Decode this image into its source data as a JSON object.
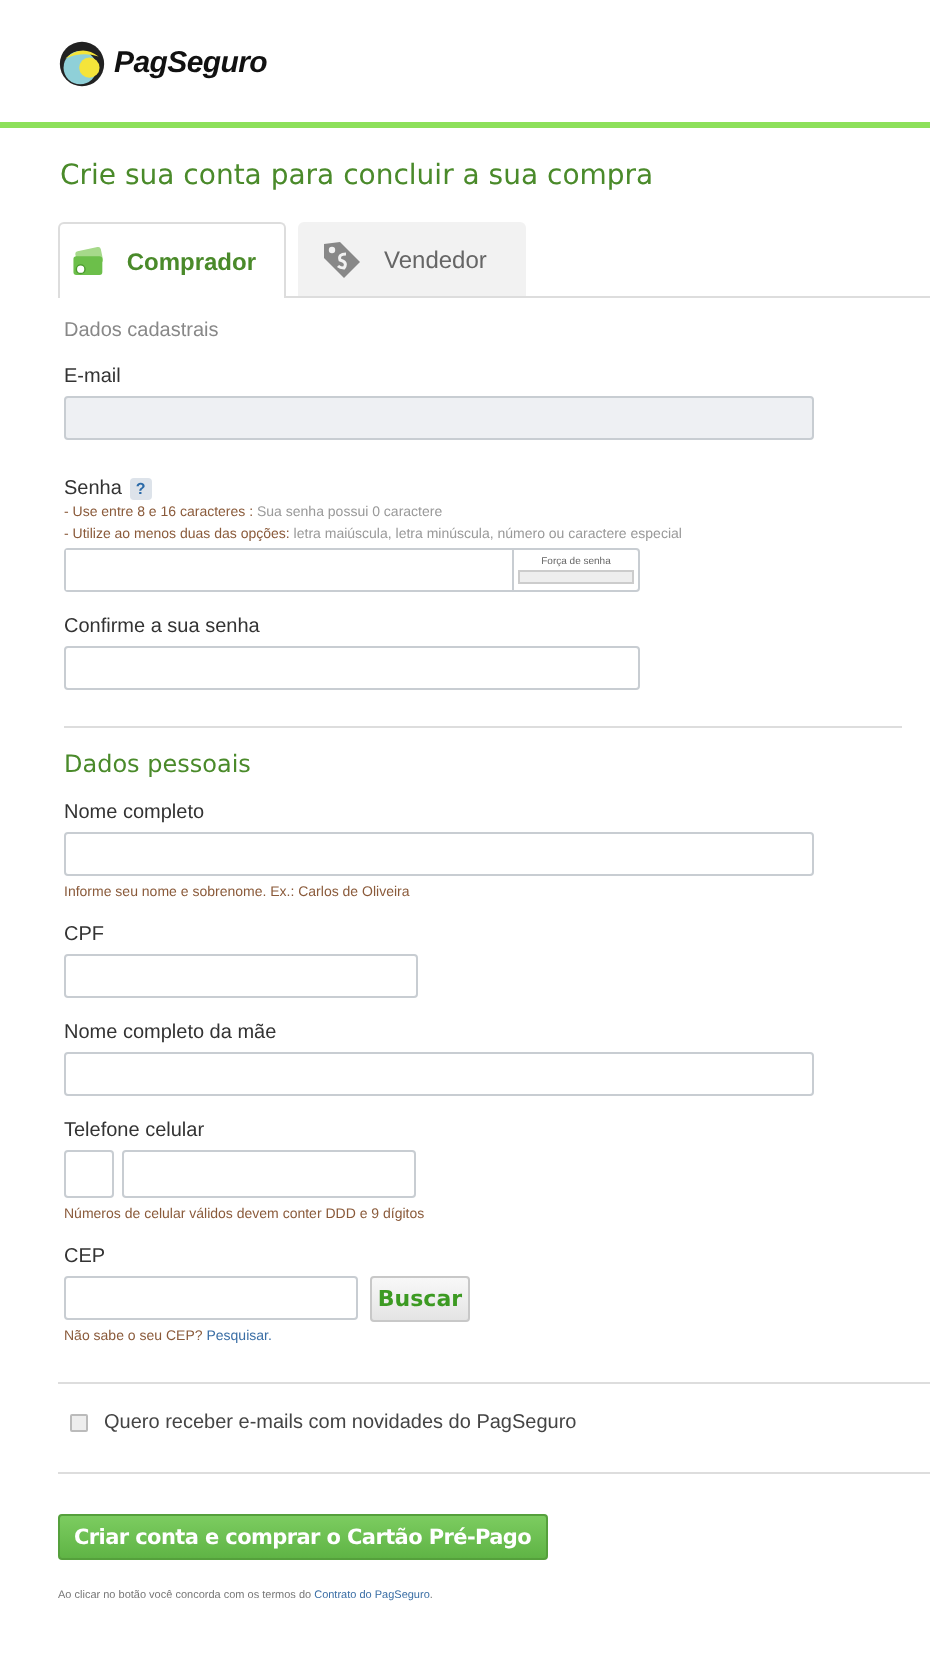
{
  "header": {
    "brand": "PagSeguro"
  },
  "title": "Crie sua conta para concluir a sua compra",
  "tabs": [
    {
      "label": "Comprador",
      "selected": true
    },
    {
      "label": "Vendedor",
      "selected": false
    }
  ],
  "account": {
    "heading": "Dados cadastrais",
    "email": {
      "label": "E-mail",
      "disabled": true
    },
    "password": {
      "label": "Senha",
      "help": "?",
      "rules": [
        {
          "text": "- Use entre 8 e 16 caracteres : ",
          "detail": "Sua senha possui 0 caractere"
        },
        {
          "text": "- Utilize ao menos duas das opções: ",
          "detail": "letra maiúscula, letra minúscula, número ou caractere especial"
        }
      ],
      "strength_label": "Força de senha"
    },
    "confirm": {
      "label": "Confirme a sua senha"
    }
  },
  "personal": {
    "heading": "Dados pessoais",
    "name": {
      "label": "Nome completo",
      "hint": "Informe seu nome e sobrenome. Ex.: Carlos de Oliveira"
    },
    "cpf": {
      "label": "CPF"
    },
    "mother": {
      "label": "Nome completo da mãe"
    },
    "phone": {
      "label": "Telefone celular",
      "hint": "Números de celular válidos devem conter DDD e 9 dígitos"
    },
    "cep": {
      "label": "CEP",
      "button": "Buscar",
      "hint": "Não sabe o seu CEP? ",
      "link": "Pesquisar."
    }
  },
  "newsletter": {
    "label": "Quero receber e-mails com novidades do PagSeguro",
    "checked": false
  },
  "submit": "Criar conta e comprar o Cartão Pré-Pago",
  "footer": {
    "text": "Ao clicar no botão você concorda com os termos do ",
    "link": "Contrato do PagSeguro",
    "end": "."
  }
}
